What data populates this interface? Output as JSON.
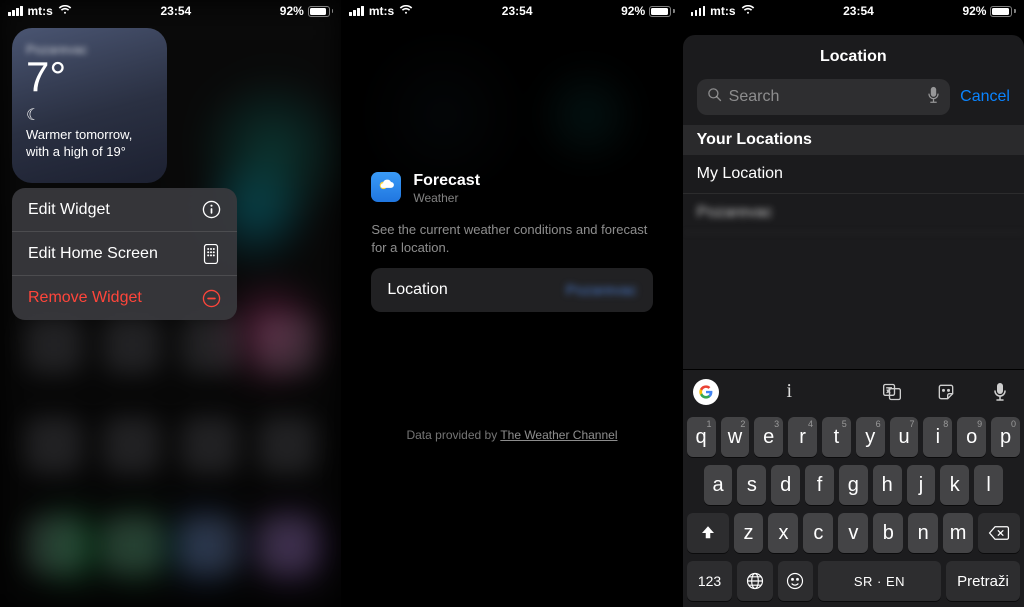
{
  "status": {
    "carrier": "mt:s",
    "time": "23:54",
    "battery_pct": "92%"
  },
  "panel1": {
    "widget": {
      "location_blurred": "Pozarevac",
      "temp": "7°",
      "moon": "☾",
      "desc": "Warmer tomorrow, with a high of 19°"
    },
    "menu": {
      "edit_widget": "Edit Widget",
      "edit_home": "Edit Home Screen",
      "remove": "Remove Widget"
    }
  },
  "panel2": {
    "title": "Forecast",
    "subtitle": "Weather",
    "desc": "See the current weather conditions and forecast for a location.",
    "row_label": "Location",
    "row_value_blurred": "Pozarevac",
    "attr_prefix": "Data provided by ",
    "attr_link": "The Weather Channel"
  },
  "panel3": {
    "nav_title": "Location",
    "search_placeholder": "Search",
    "cancel": "Cancel",
    "section": "Your Locations",
    "items": [
      "My Location",
      "Pozarevac"
    ]
  },
  "keyboard": {
    "suggestion": "i",
    "rows": {
      "r1": [
        "q",
        "w",
        "e",
        "r",
        "t",
        "y",
        "u",
        "i",
        "o",
        "p"
      ],
      "nums": [
        "1",
        "2",
        "3",
        "4",
        "5",
        "6",
        "7",
        "8",
        "9",
        "0"
      ],
      "r2": [
        "a",
        "s",
        "d",
        "f",
        "g",
        "h",
        "j",
        "k",
        "l"
      ],
      "r3": [
        "z",
        "x",
        "c",
        "v",
        "b",
        "n",
        "m"
      ]
    },
    "k123": "123",
    "space": "SR · EN",
    "search": "Pretraži"
  }
}
